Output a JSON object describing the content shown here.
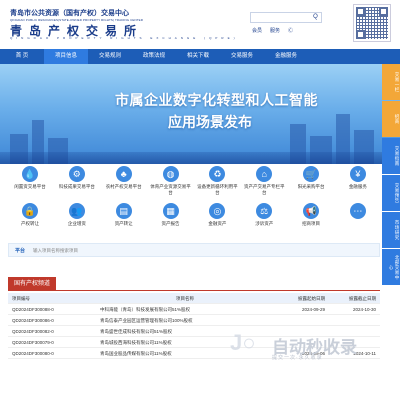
{
  "header": {
    "org_name_cn": "青岛市公共资源（国有产权）交易中心",
    "org_name_en": "QINGDAO PUBLIC RESOURCES(STATE-OWNED PROPERTY RIGHTS) TRADING CENTER",
    "logo_cn": "青岛产权交易所",
    "logo_en": "QINGDAO PROPERTY RIGHTS EXCHANGE (QPRE)",
    "search_placeholder": "",
    "search_button": "Q",
    "links": [
      "会员",
      "服务",
      "Ⓒ"
    ]
  },
  "nav": {
    "items": [
      {
        "label": "首  页",
        "active": false
      },
      {
        "label": "项目信息",
        "active": true
      },
      {
        "label": "交易规则",
        "active": false
      },
      {
        "label": "政策法规",
        "active": false
      },
      {
        "label": "相关下载",
        "active": false
      },
      {
        "label": "交易服务",
        "active": false
      },
      {
        "label": "金融服务",
        "active": false
      },
      {
        "label": "",
        "active": false
      }
    ]
  },
  "banner": {
    "line1": "市属企业数字化转型和人工智能",
    "line2": "应用场景发布"
  },
  "side_tabs": [
    "交易一栏",
    "招商",
    "交易指南",
    "交易预告",
    "市场研究",
    "北部交易中心"
  ],
  "services_row1": [
    {
      "icon": "water-drop-icon",
      "label": "闲置资交易平台"
    },
    {
      "icon": "chip-icon",
      "label": "科技成果交易平台"
    },
    {
      "icon": "tree-icon",
      "label": "农村产权交易平台"
    },
    {
      "icon": "basketball-icon",
      "label": "体育产业资源交易平台"
    },
    {
      "icon": "recycle-icon",
      "label": "设备更新循环利用平台"
    },
    {
      "icon": "house-icon",
      "label": "资产产交易产专栏平台"
    },
    {
      "icon": "cart-icon",
      "label": "阳光采购平台"
    },
    {
      "icon": "money-icon",
      "label": "金融服务"
    }
  ],
  "services_row2": [
    {
      "icon": "lock-icon",
      "label": "产权转让"
    },
    {
      "icon": "users-icon",
      "label": "企业增资"
    },
    {
      "icon": "document-icon",
      "label": "资产转让"
    },
    {
      "icon": "chart-icon",
      "label": "资产报告"
    },
    {
      "icon": "coin-icon",
      "label": "金融资产"
    },
    {
      "icon": "gavel-icon",
      "label": "涉诉资产"
    },
    {
      "icon": "megaphone-icon",
      "label": "招商项目"
    },
    {
      "icon": "more-icon",
      "label": ""
    }
  ],
  "notice": {
    "label": "平台",
    "placeholder": "输入项目名称搜索项目"
  },
  "section": {
    "tab": "国有产权频道"
  },
  "table": {
    "headers": [
      "项目编号",
      "项目名称",
      "披露起始日期",
      "披露截止日期"
    ],
    "rows": [
      [
        "QD2024DF300088-0",
        "中科海能（青岛）科技发展有限公司51%股权",
        "2024-09-29",
        "2024-10-30"
      ],
      [
        "QD2024DF300086-0",
        "青岛信泰产业园区运营管理有限公司100%股权",
        "",
        ""
      ],
      [
        "QD2024DF300082-0",
        "青岛盛世佳成科技有限公司51%股权",
        "",
        ""
      ],
      [
        "QD2024DF300079-0",
        "青岛城投西海科技有限公司11%股权",
        "",
        ""
      ],
      [
        "QD2024DF300080-0",
        "青岛国业股品传媒有限公司11%股权",
        "2024-09-06",
        "2024-10-11"
      ]
    ]
  },
  "watermark": {
    "brand": "自动秒收录",
    "tagline": "提交一次·永久收录"
  },
  "colors": {
    "nav_bg": "#1d5db7",
    "nav_active": "#2f7be0",
    "accent_red": "#c0392b",
    "side_orange": "#f3a738"
  }
}
